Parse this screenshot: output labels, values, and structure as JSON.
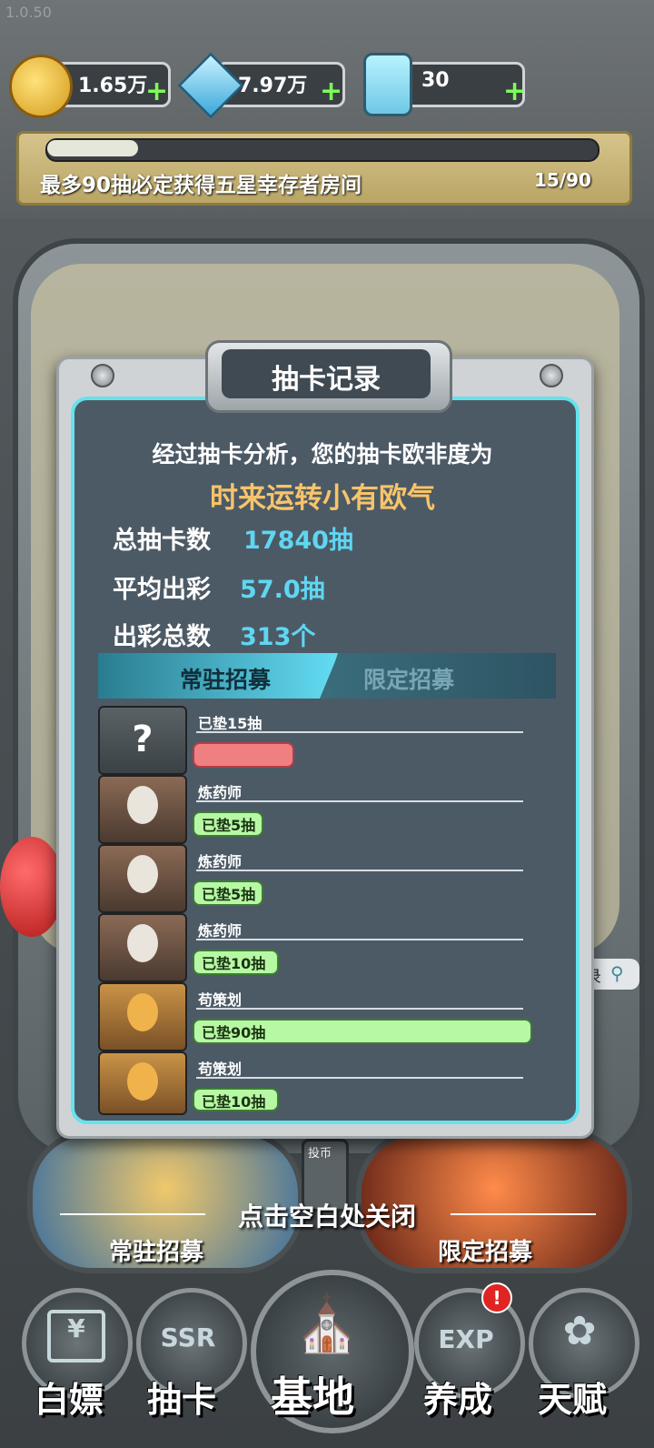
{
  "version": "1.0.50",
  "resources": [
    {
      "name": "gold-coin",
      "value": "1.65万"
    },
    {
      "name": "crystal",
      "value": "7.97万"
    },
    {
      "name": "energy",
      "value": "30"
    }
  ],
  "pity": {
    "text": "最多90抽必定获得五星幸存者房间",
    "count": "15/90",
    "progress": 0.1667
  },
  "modal": {
    "title": "抽卡记录",
    "analysis": "经过抽卡分析，您的抽卡欧非度为",
    "verdict": "时来运转小有欧气",
    "stats": [
      {
        "label": "总抽卡数",
        "value": "17840抽"
      },
      {
        "label": "平均出彩",
        "value": "57.0抽"
      },
      {
        "label": "出彩总数",
        "value": "313个"
      }
    ],
    "tabs": [
      {
        "label": "常驻招募",
        "active": true
      },
      {
        "label": "限定招募",
        "active": false
      }
    ],
    "records": [
      {
        "name": "已垫15抽",
        "pill": "",
        "pity_fraction": 0.167,
        "type": "unknown",
        "color": "#f07f82"
      },
      {
        "name": "炼药师",
        "pill": "已垫5抽",
        "pity_fraction": 0.056,
        "type": "alchemist",
        "color": "#b7f8a5"
      },
      {
        "name": "炼药师",
        "pill": "已垫5抽",
        "pity_fraction": 0.056,
        "type": "alchemist",
        "color": "#b7f8a5"
      },
      {
        "name": "炼药师",
        "pill": "已垫10抽",
        "pity_fraction": 0.111,
        "type": "alchemist",
        "color": "#b7f8a5"
      },
      {
        "name": "苟策划",
        "pill": "已垫90抽",
        "pity_fraction": 1.0,
        "type": "doge",
        "color": "#b7f8a5"
      },
      {
        "name": "苟策划",
        "pill": "已垫10抽",
        "pity_fraction": 0.111,
        "type": "doge",
        "color": "#b7f8a5"
      }
    ]
  },
  "close_hint": "点击空白处关闭",
  "recruit_buttons": {
    "normal": "常驻招募",
    "limited": "限定招募",
    "coin_slot": "投币"
  },
  "nav": {
    "items": [
      {
        "label": "白嫖",
        "icon": "ticket-icon"
      },
      {
        "label": "抽卡",
        "icon": "ssr-icon"
      },
      {
        "label": "基地",
        "icon": "base-icon"
      },
      {
        "label": "养成",
        "icon": "exp-icon",
        "badge": "!"
      },
      {
        "label": "天赋",
        "icon": "talent-icon"
      }
    ],
    "icon_texts": {
      "ssr": "SSR",
      "exp": "EXP"
    }
  },
  "search_tag": "录",
  "colors": {
    "accent_cyan": "#5fd6f2",
    "verdict_gold": "#f8c46a",
    "pill_green": "#b7f8a5",
    "pill_red": "#f07f82",
    "badge_red": "#e02424"
  }
}
